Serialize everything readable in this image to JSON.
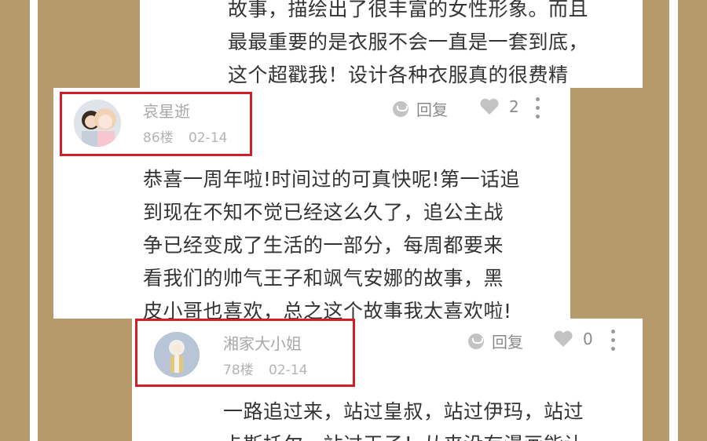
{
  "colors": {
    "background": "#b69a6c",
    "highlight": "#d41e26",
    "card": "#ffffff"
  },
  "top_card": {
    "lines": [
      "故事，描绘出了很丰富的女性形象。而且",
      "最最重要的是衣服不会一直是一套到底，",
      "这个超戳我！设计各种衣服真的很费精"
    ]
  },
  "comment1": {
    "username": "哀星逝",
    "floor": "86楼",
    "date": "02-14",
    "reply_label": "回复",
    "likes": "2",
    "lines": [
      "恭喜一周年啦!时间过的可真快呢!第一话追",
      "到现在不知不觉已经这么久了，追公主战",
      "争已经变成了生活的一部分，每周都要来",
      "看我们的帅气王子和飒气安娜的故事，黑",
      "皮小哥也喜欢，总之这个故事我太喜欢啦!"
    ]
  },
  "comment2": {
    "username": "湘家大小姐",
    "floor": "78楼",
    "date": "02-14",
    "reply_label": "回复",
    "likes": "0",
    "lines": [
      "一路追过来，站过皇叔，站过伊玛，站过",
      "卡斯托尔，站过王子！从来没有漫画能让"
    ]
  }
}
